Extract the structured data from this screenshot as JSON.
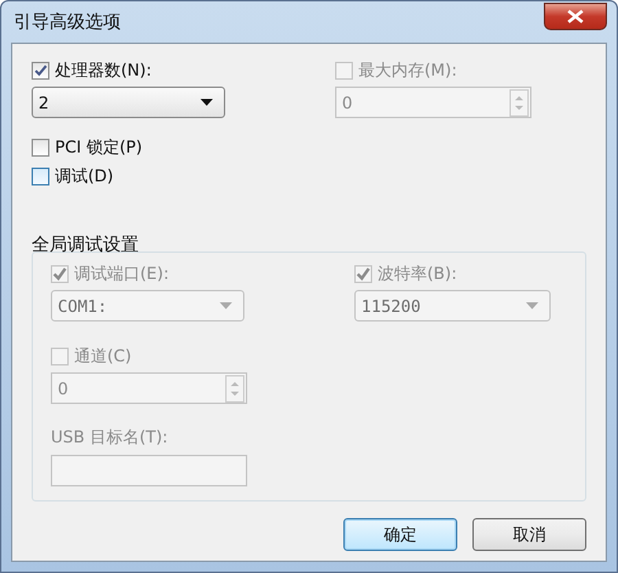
{
  "window": {
    "title": "引导高级选项"
  },
  "processors": {
    "label": "处理器数(N):",
    "checked": true,
    "value": "2"
  },
  "max_memory": {
    "label": "最大内存(M):",
    "checked": false,
    "value": "0",
    "disabled": true
  },
  "pci_lock": {
    "label": "PCI 锁定(P)",
    "checked": false
  },
  "debug": {
    "label": "调试(D)",
    "checked": false,
    "focused": true
  },
  "group": {
    "title": "全局调试设置",
    "debug_port": {
      "label": "调试端口(E):",
      "checked": true,
      "disabled": true,
      "value": "COM1:"
    },
    "baud_rate": {
      "label": "波特率(B):",
      "checked": true,
      "disabled": true,
      "value": "115200"
    },
    "channel": {
      "label": "通道(C)",
      "checked": false,
      "disabled": true,
      "value": "0"
    },
    "usb_target": {
      "label": "USB 目标名(T):",
      "disabled": true
    }
  },
  "buttons": [
    {
      "label": "确定",
      "default": true
    },
    {
      "label": "取消",
      "default": false
    }
  ]
}
